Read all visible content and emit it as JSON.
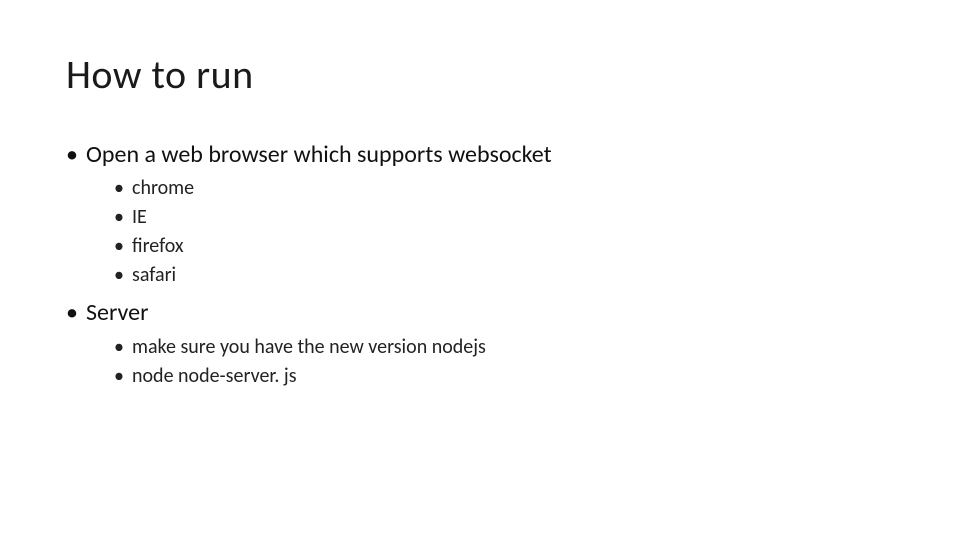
{
  "title": "How to run",
  "bullets": [
    {
      "text": "Open a web browser which supports websocket",
      "sub": [
        {
          "text": "chrome"
        },
        {
          "text": "IE"
        },
        {
          "text": "firefox"
        },
        {
          "text": "safari"
        }
      ]
    },
    {
      "text": "Server",
      "sub": [
        {
          "text": "make sure you have the new version nodejs"
        },
        {
          "text": "node node-server. js"
        }
      ]
    }
  ]
}
